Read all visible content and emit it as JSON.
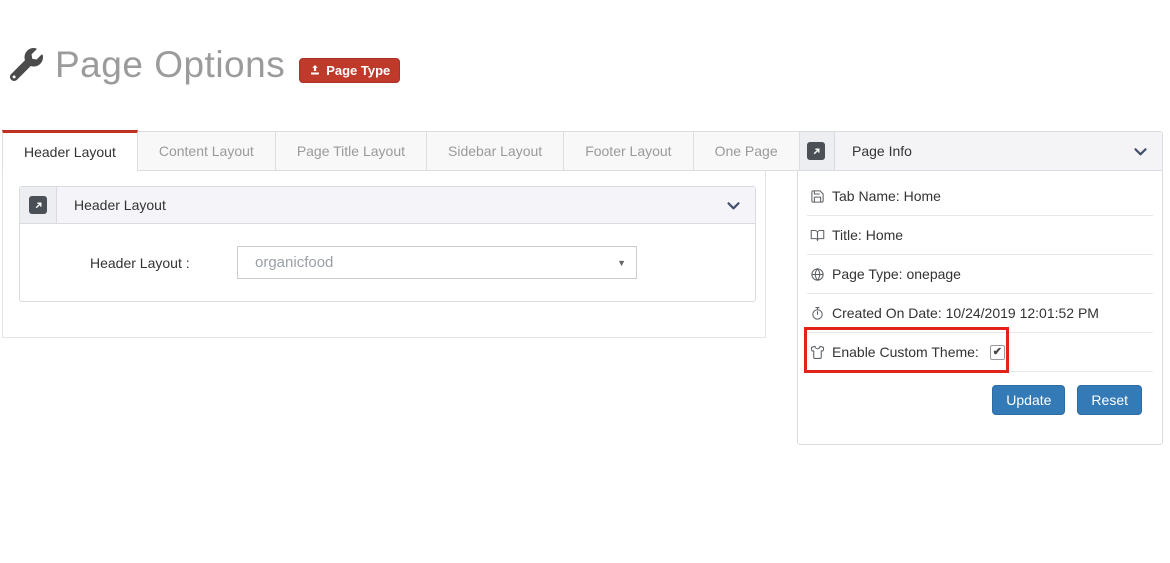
{
  "page_header": {
    "title": "Page Options",
    "badge_label": "Page Type"
  },
  "tabs": [
    {
      "label": "Header Layout",
      "active": true
    },
    {
      "label": "Content Layout",
      "active": false
    },
    {
      "label": "Page Title Layout",
      "active": false
    },
    {
      "label": "Sidebar Layout",
      "active": false
    },
    {
      "label": "Footer Layout",
      "active": false
    },
    {
      "label": "One Page",
      "active": false
    }
  ],
  "header_layout_panel": {
    "title": "Header Layout",
    "field_label": "Header Layout :",
    "select_value": "organicfood"
  },
  "page_info_panel": {
    "title": "Page Info",
    "rows": [
      {
        "icon": "save-icon",
        "text": "Tab Name: Home"
      },
      {
        "icon": "book-icon",
        "text": "Title: Home"
      },
      {
        "icon": "globe-icon",
        "text": "Page Type: onepage"
      },
      {
        "icon": "stopwatch-icon",
        "text": "Created On Date: 10/24/2019 12:01:52 PM"
      },
      {
        "icon": "tshirt-icon",
        "text": "Enable Custom Theme:",
        "checkbox_checked": true,
        "checkmark": "✔"
      }
    ],
    "buttons": [
      {
        "label": "Update"
      },
      {
        "label": "Reset"
      }
    ]
  },
  "colors": {
    "accent_red": "#bf3122",
    "badge_red": "#bf3a2b",
    "highlight_red": "#e2231a",
    "button_blue": "#337ab7"
  }
}
